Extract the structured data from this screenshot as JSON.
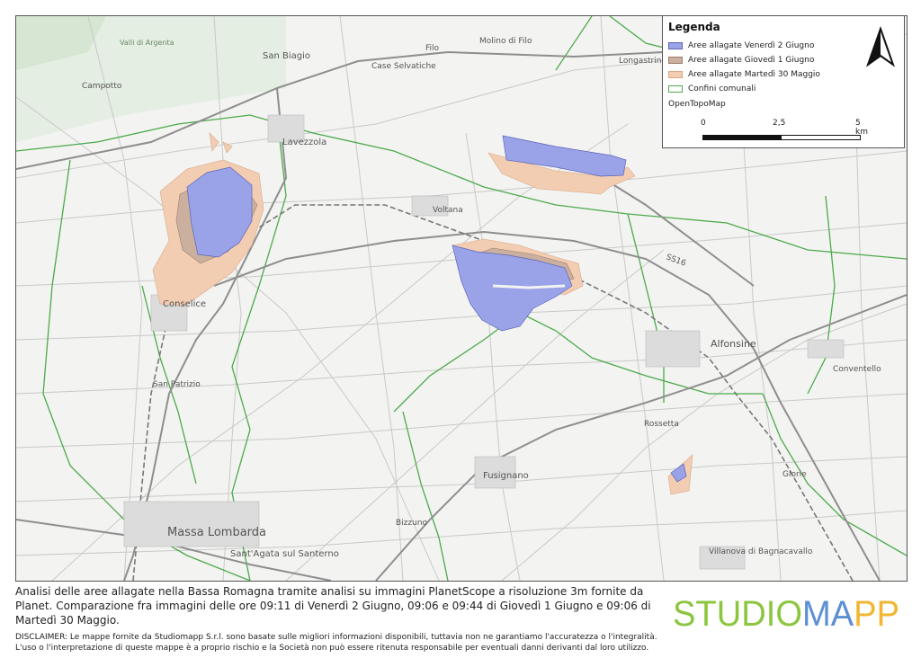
{
  "legend": {
    "title": "Legenda",
    "items": [
      {
        "label": "Aree allagate Venerdì 2 Giugno",
        "color": "#9aa3e8",
        "border": "#5d64b8",
        "kind": "fill"
      },
      {
        "label": "Aree allagate Giovedì 1 Giugno",
        "color": "#cbb09f",
        "border": "#9b7e6d",
        "kind": "fill"
      },
      {
        "label": "Aree allagate Martedì 30 Maggio",
        "color": "#f2cdb2",
        "border": "#d9a889",
        "kind": "fill"
      },
      {
        "label": "Confini comunali",
        "color": "#4caa4c",
        "border": "#4caa4c",
        "kind": "line"
      }
    ],
    "basemap": "OpenTopoMap",
    "scale": {
      "ticks": [
        "0",
        "2,5",
        "5 km"
      ]
    }
  },
  "places": {
    "san_biagio": "San Biagio",
    "case_selvatiche": "Case Selvatiche",
    "filo": "Filo",
    "molino_di_filo": "Molino di Filo",
    "longastrino": "Longastrino",
    "campotto": "Campotto",
    "lavezzola": "Lavezzola",
    "voltana": "Voltana",
    "conselice": "Conselice",
    "san_patrizio": "San Patrizio",
    "alfonsine": "Alfonsine",
    "conventello": "Conventello",
    "rossetta": "Rossetta",
    "fusignano": "Fusignano",
    "glorie": "Glorie",
    "bizzuno": "Bizzuno",
    "massa_lombarda": "Massa Lombarda",
    "santagata": "Sant'Agata sul Santerno",
    "villanova": "Villanova di Bagnacavallo",
    "ss16": "SS16",
    "argenta": "Valli di Argenta"
  },
  "caption": "Analisi delle aree allagate nella Bassa Romagna tramite analisi su immagini PlanetScope a risoluzione 3m fornite da Planet. Comparazione fra immagini delle ore 09:11 di Venerdì 2 Giugno, 09:06 e 09:44 di Giovedì 1 Giugno e 09:06 di Martedì 30 Maggio.",
  "disclaimer_line1": "DISCLAIMER: Le mappe fornite da Studiomapp S.r.l. sono basate sulle migliori informazioni disponibili, tuttavia non ne garantiamo l'accuratezza o l'integralità.",
  "disclaimer_line2": "L'uso o l'interpretazione di queste mappe è a proprio rischio e la Società non può essere ritenuta responsabile per eventuali danni derivanti dal loro utilizzo.",
  "logo": {
    "part1": "STUDIO",
    "part2": "MA",
    "part3": "PP",
    "color1": "#8cc63f",
    "color2": "#5b8fd4",
    "color3": "#f2b632"
  }
}
